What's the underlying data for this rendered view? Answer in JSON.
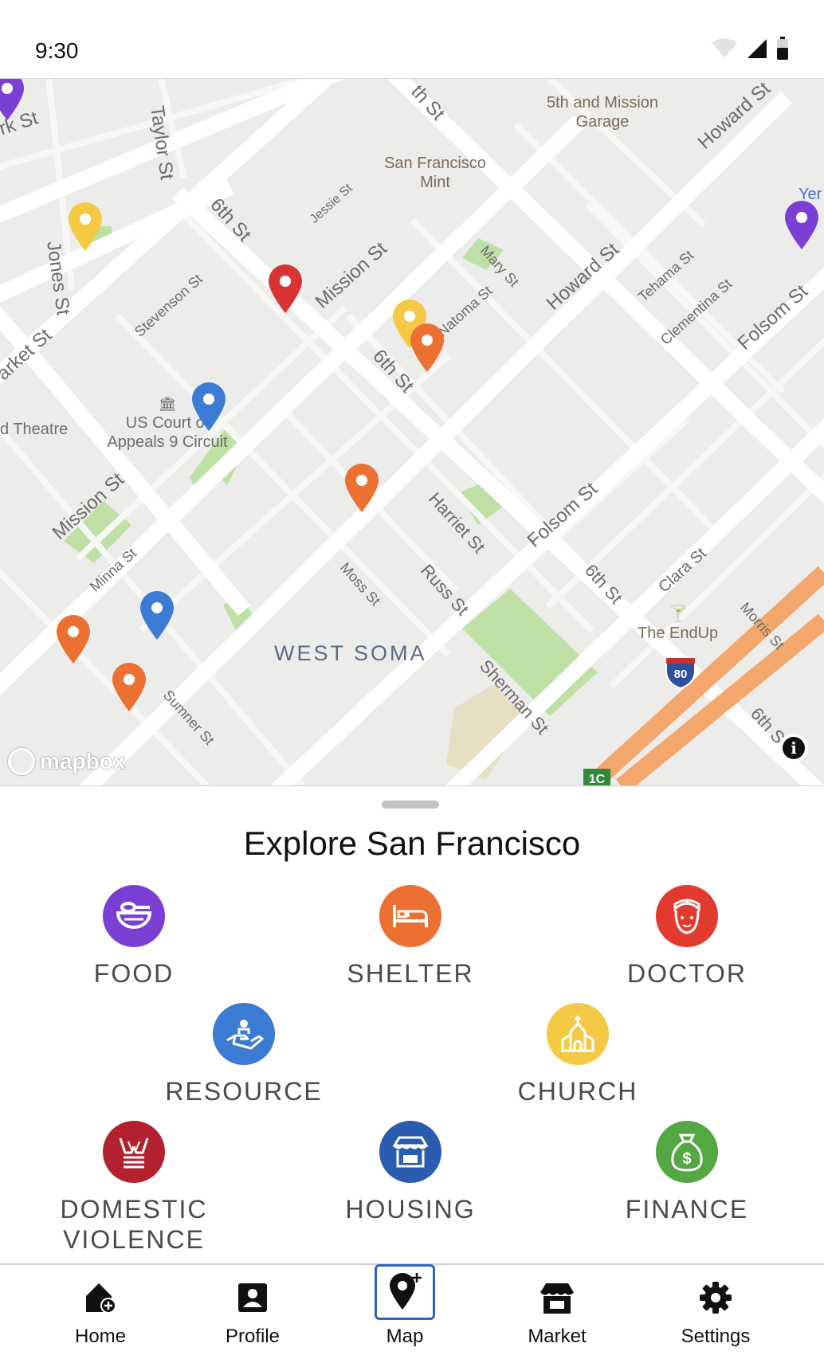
{
  "status_bar": {
    "time": "9:30"
  },
  "map": {
    "streets": [
      {
        "name": "rk St"
      },
      {
        "name": "Taylor St"
      },
      {
        "name": "th St"
      },
      {
        "name": "5th and Mission Garage"
      },
      {
        "name": "San Francisco Mint"
      },
      {
        "name": "Howard St"
      },
      {
        "name": "Jessie St"
      },
      {
        "name": "6th St"
      },
      {
        "name": "Mission St"
      },
      {
        "name": "Jones St"
      },
      {
        "name": "Mary St"
      },
      {
        "name": "Howard St"
      },
      {
        "name": "Tehama St"
      },
      {
        "name": "Clementina St"
      },
      {
        "name": "Folsom St"
      },
      {
        "name": "Stevenson St"
      },
      {
        "name": "Natoma St"
      },
      {
        "name": "arket St"
      },
      {
        "name": "6th St"
      },
      {
        "name": "US Court of Appeals 9 Circuit"
      },
      {
        "name": "d Theatre"
      },
      {
        "name": "Mission St"
      },
      {
        "name": "Harriet St"
      },
      {
        "name": "Folsom St"
      },
      {
        "name": "Minna St"
      },
      {
        "name": "Moss St"
      },
      {
        "name": "Russ St"
      },
      {
        "name": "6th St"
      },
      {
        "name": "Clara St"
      },
      {
        "name": "The EndUp"
      },
      {
        "name": "Morris St"
      },
      {
        "name": "Sherman St"
      },
      {
        "name": "WEST SOMA"
      },
      {
        "name": "Sumner St"
      },
      {
        "name": "6th S"
      },
      {
        "name": "Yer"
      }
    ],
    "shields": {
      "interstate": "80",
      "exit": "1C"
    },
    "pins": [
      {
        "category": "doctor",
        "color": "#d93434"
      },
      {
        "category": "church",
        "color": "#f6c944"
      },
      {
        "category": "church",
        "color": "#f6c944"
      },
      {
        "category": "shelter",
        "color": "#ec7031"
      },
      {
        "category": "shelter",
        "color": "#ec7031"
      },
      {
        "category": "shelter",
        "color": "#ec7031"
      },
      {
        "category": "shelter",
        "color": "#ec7031"
      },
      {
        "category": "resource",
        "color": "#3c7bd4"
      },
      {
        "category": "resource",
        "color": "#3c7bd4"
      },
      {
        "category": "food",
        "color": "#7b3fd6"
      },
      {
        "category": "food",
        "color": "#7b3fd6"
      }
    ],
    "attribution": "mapbox"
  },
  "sheet": {
    "title": "Explore San Francisco",
    "categories": [
      {
        "label": "FOOD",
        "color": "#7b3fd6",
        "icon": "bowl-icon"
      },
      {
        "label": "SHELTER",
        "color": "#ec7031",
        "icon": "bed-icon"
      },
      {
        "label": "DOCTOR",
        "color": "#e23a2e",
        "icon": "nurse-icon"
      },
      {
        "label": "RESOURCE",
        "color": "#3c7bd4",
        "icon": "hand-giving-icon"
      },
      {
        "label": "CHURCH",
        "color": "#f6c944",
        "icon": "church-icon"
      },
      {
        "label": "DOMESTIC\nVIOLENCE",
        "color": "#b3212f",
        "icon": "hands-icon"
      },
      {
        "label": "HOUSING",
        "color": "#2a5db0",
        "icon": "store-house-icon"
      },
      {
        "label": "FINANCE",
        "color": "#54a844",
        "icon": "money-bag-icon"
      }
    ]
  },
  "nav": {
    "items": [
      {
        "label": "Home",
        "icon": "home-plus-icon"
      },
      {
        "label": "Profile",
        "icon": "profile-icon"
      },
      {
        "label": "Map",
        "icon": "map-pin-plus-icon",
        "active": true
      },
      {
        "label": "Market",
        "icon": "storefront-icon"
      },
      {
        "label": "Settings",
        "icon": "gear-icon"
      }
    ],
    "active_color": "#2f63b9"
  }
}
